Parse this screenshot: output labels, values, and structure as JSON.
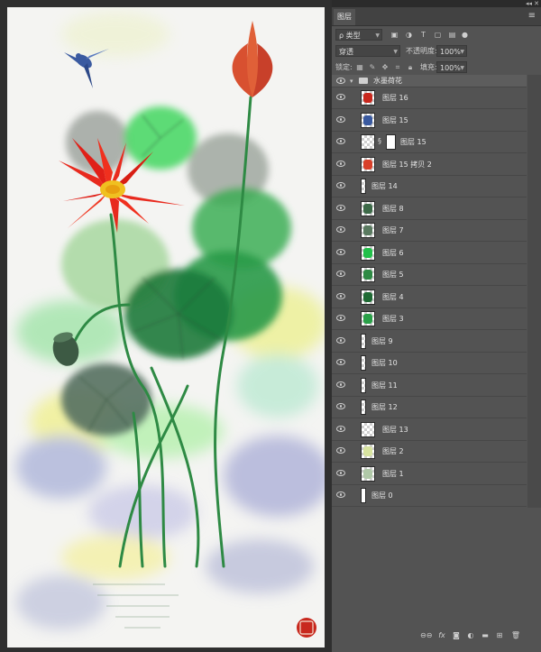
{
  "panel": {
    "tab_label": "图层",
    "filter_kind": "ρ 类型",
    "blend_mode": "穿透",
    "opacity_label": "不透明度:",
    "opacity_value": "100%",
    "lock_label": "锁定:",
    "fill_label": "填充:",
    "fill_value": "100%"
  },
  "layers": [
    {
      "name": "水墨荷花",
      "type": "group"
    },
    {
      "name": "图层 16",
      "thumb": "#c8281e"
    },
    {
      "name": "图层 15",
      "thumb": "#3a5aa0"
    },
    {
      "name": "图层 15",
      "thumb": "",
      "has_mask": true
    },
    {
      "name": "图层 15 拷贝 2",
      "thumb": "#d8402a"
    },
    {
      "name": "图层 14",
      "thumb": "",
      "narrow": true
    },
    {
      "name": "图层 8",
      "thumb": "#3d6a48"
    },
    {
      "name": "图层 7",
      "thumb": "#5a7a60"
    },
    {
      "name": "图层 6",
      "thumb": "#22c04a"
    },
    {
      "name": "图层 5",
      "thumb": "#2e8a44"
    },
    {
      "name": "图层 4",
      "thumb": "#1f6a34"
    },
    {
      "name": "图层 3",
      "thumb": "#2aa048"
    },
    {
      "name": "图层 9",
      "thumb": "",
      "narrow": true
    },
    {
      "name": "图层 10",
      "thumb": "",
      "narrow": true
    },
    {
      "name": "图层 11",
      "thumb": "",
      "narrow": true
    },
    {
      "name": "图层 12",
      "thumb": "",
      "narrow": true
    },
    {
      "name": "图层 13",
      "thumb": ""
    },
    {
      "name": "图层 2",
      "thumb": "#d8e4a0"
    },
    {
      "name": "图层 1",
      "thumb": "#b0c8a8"
    },
    {
      "name": "图层 0",
      "thumb": "#ffffff",
      "narrow": true
    }
  ],
  "colors": {
    "panel_bg": "#535353",
    "accent_red": "#e82a1e",
    "leaf_green": "#1e7a3c"
  }
}
